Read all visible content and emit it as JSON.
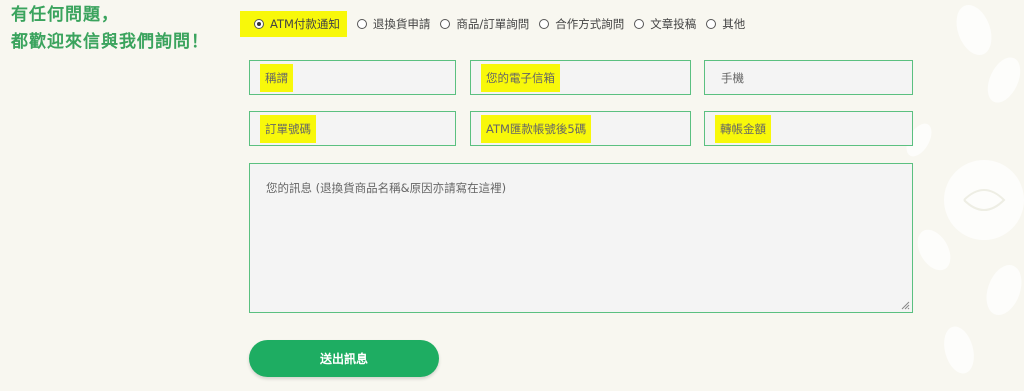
{
  "headline": {
    "line1": "有任何問題，",
    "line2": "都歡迎來信與我們詢問！"
  },
  "inquiry_types": [
    {
      "label": "ATM付款通知",
      "selected": true
    },
    {
      "label": "退換貨申請",
      "selected": false
    },
    {
      "label": "商品/訂單詢問",
      "selected": false
    },
    {
      "label": "合作方式詢問",
      "selected": false
    },
    {
      "label": "文章投稿",
      "selected": false
    },
    {
      "label": "其他",
      "selected": false
    }
  ],
  "fields": {
    "name": {
      "placeholder": "稱謂"
    },
    "email": {
      "placeholder": "您的電子信箱"
    },
    "phone": {
      "placeholder": "手機"
    },
    "order_no": {
      "placeholder": "訂單號碼"
    },
    "atm_last5": {
      "placeholder": "ATM匯款帳號後5碼"
    },
    "amount": {
      "placeholder": "轉帳金額"
    }
  },
  "message": {
    "placeholder": "您的訊息 (退換貨商品名稱&原因亦請寫在這裡)"
  },
  "submit_label": "送出訊息",
  "colors": {
    "accent": "#3aa35d",
    "button": "#1ead62",
    "highlight": "#f8f80a",
    "field_border": "#5bc080"
  }
}
